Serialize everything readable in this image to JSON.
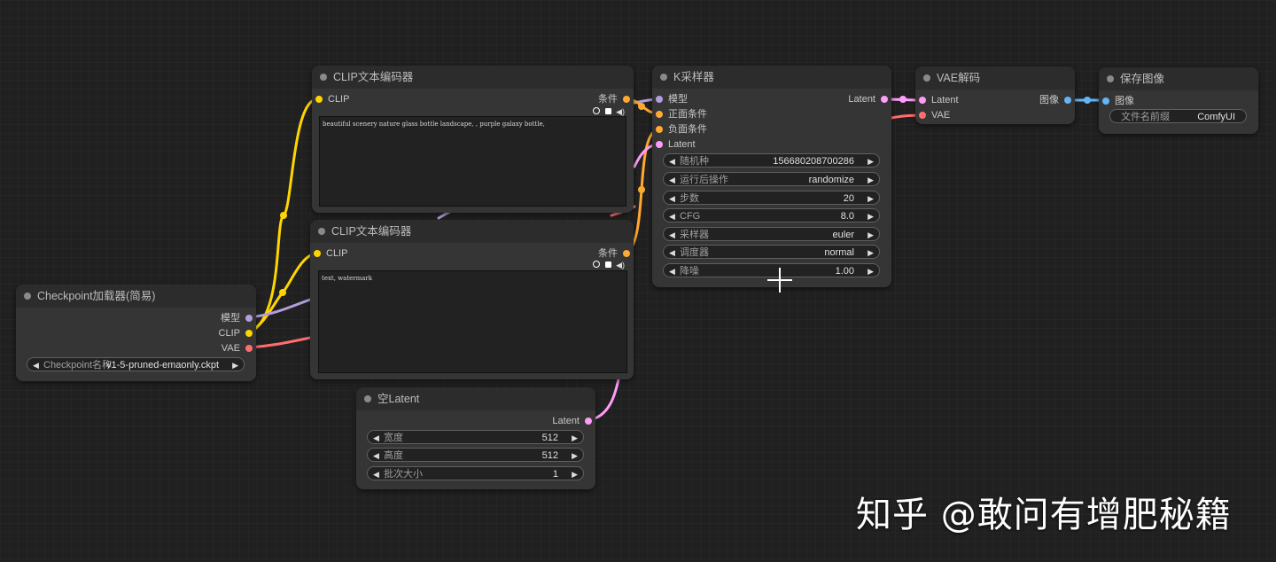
{
  "colors": {
    "clip": "#ffd500",
    "model": "#b39ddb",
    "vae": "#ff6e6e",
    "conditioning": "#ffa931",
    "latent": "#ff9cf9",
    "image": "#64b5f6"
  },
  "nodes": {
    "checkpoint": {
      "title": "Checkpoint加载器(简易)",
      "out_model": "模型",
      "out_clip": "CLIP",
      "out_vae": "VAE",
      "ckpt_label": "Checkpoint名称",
      "ckpt_value": "v1-5-pruned-emaonly.ckpt"
    },
    "clip_pos": {
      "title": "CLIP文本编码器",
      "in_clip": "CLIP",
      "out_cond": "条件",
      "text": "beautiful scenery nature glass bottle landscape, , purple galaxy bottle,"
    },
    "clip_neg": {
      "title": "CLIP文本编码器",
      "in_clip": "CLIP",
      "out_cond": "条件",
      "text": "text, watermark"
    },
    "ksampler": {
      "title": "K采样器",
      "in_model": "模型",
      "in_positive": "正面条件",
      "in_negative": "负面条件",
      "in_latent": "Latent",
      "out_latent": "Latent",
      "widgets": [
        {
          "label": "随机种",
          "value": "156680208700286"
        },
        {
          "label": "运行后操作",
          "value": "randomize"
        },
        {
          "label": "步数",
          "value": "20"
        },
        {
          "label": "CFG",
          "value": "8.0"
        },
        {
          "label": "采样器",
          "value": "euler"
        },
        {
          "label": "调度器",
          "value": "normal"
        },
        {
          "label": "降噪",
          "value": "1.00"
        }
      ]
    },
    "vae_decode": {
      "title": "VAE解码",
      "in_latent": "Latent",
      "in_vae": "VAE",
      "out_image": "图像"
    },
    "save_image": {
      "title": "保存图像",
      "in_image": "图像",
      "prefix_label": "文件名前缀",
      "prefix_value": "ComfyUI"
    },
    "empty_latent": {
      "title": "空Latent",
      "out_latent": "Latent",
      "widgets": [
        {
          "label": "宽度",
          "value": "512"
        },
        {
          "label": "高度",
          "value": "512"
        },
        {
          "label": "批次大小",
          "value": "1"
        }
      ]
    }
  },
  "watermark": "知乎 @敢问有增肥秘籍"
}
